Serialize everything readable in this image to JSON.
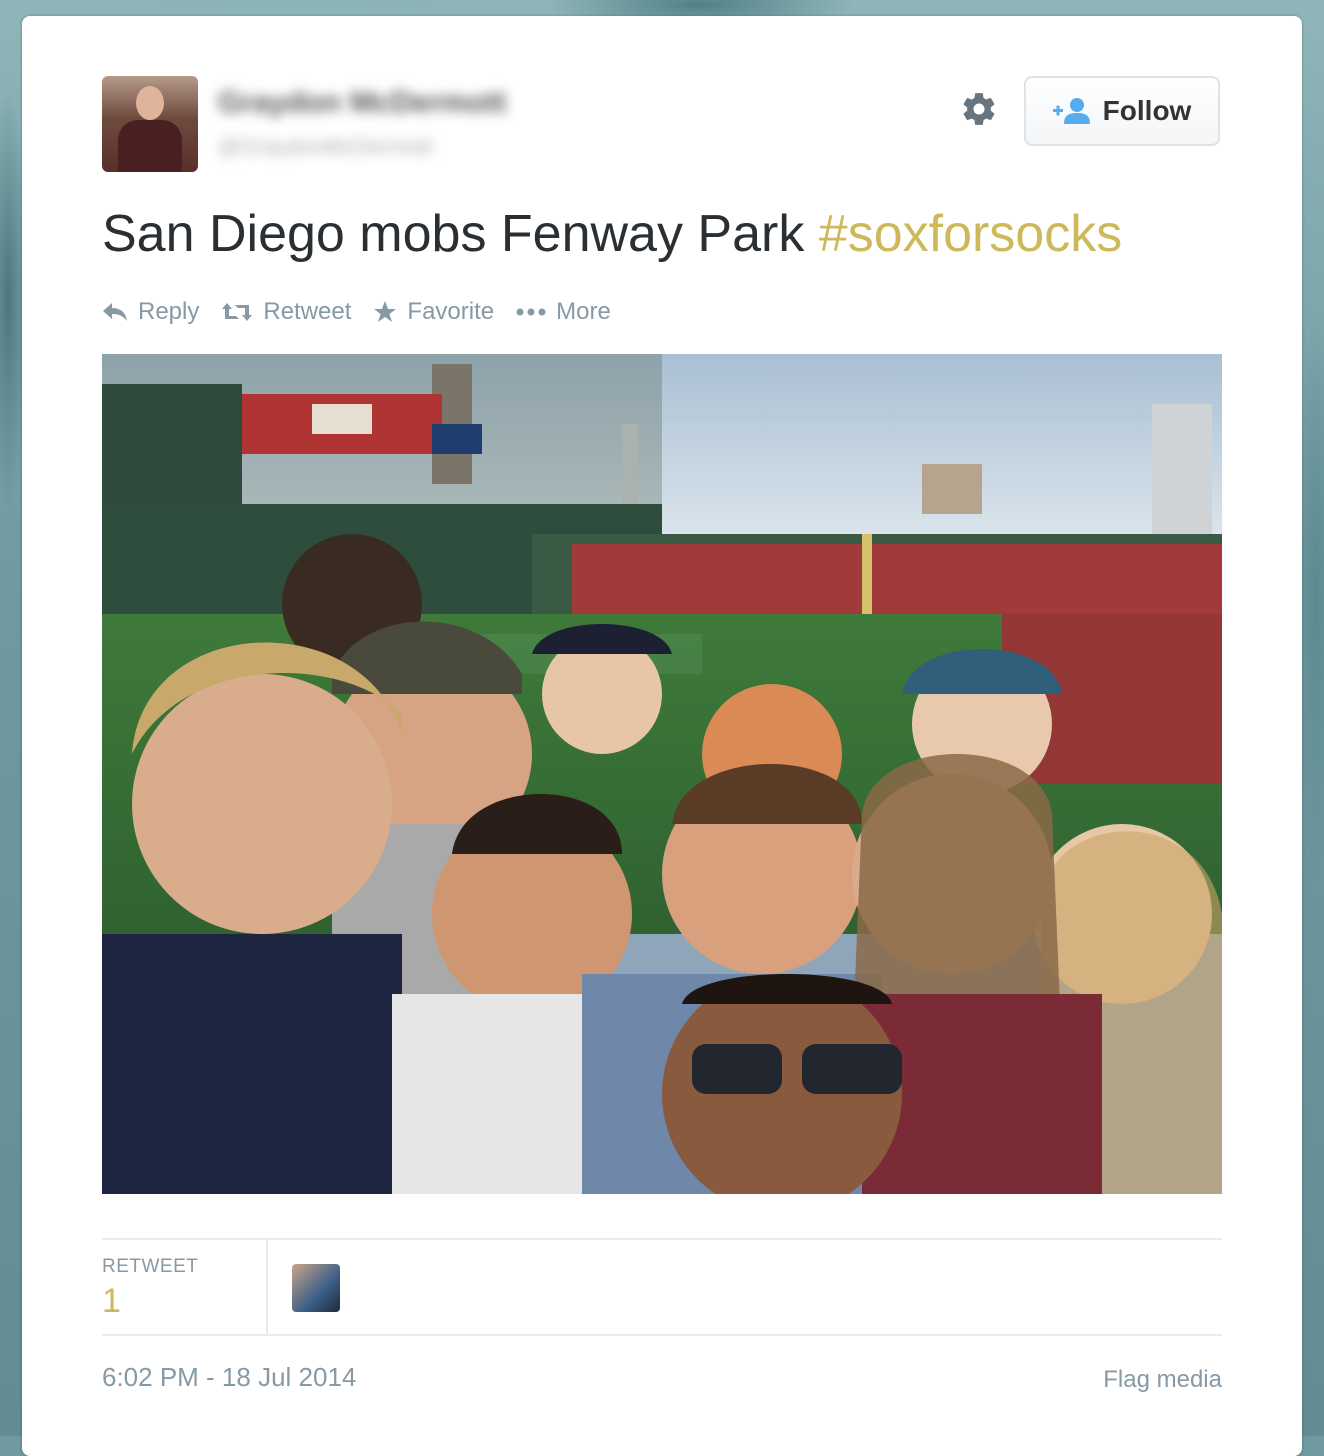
{
  "author": {
    "display_name": "Graydon McDermott",
    "handle": "@GraydonMcDermott"
  },
  "follow_button": {
    "label": "Follow"
  },
  "tweet": {
    "text": "San Diego mobs Fenway Park ",
    "hashtag": "#soxforsocks"
  },
  "actions": {
    "reply": "Reply",
    "retweet": "Retweet",
    "favorite": "Favorite",
    "more": "More"
  },
  "stats": {
    "retweet_label": "RETWEET",
    "retweet_count": "1"
  },
  "footer": {
    "timestamp": "6:02 PM - 18 Jul 2014",
    "flag_media": "Flag media"
  },
  "colors": {
    "hashtag": "#ceb95a",
    "action_gray": "#8899a6",
    "follow_icon_blue": "#55acee"
  },
  "icons": [
    "gear-icon",
    "follow-user-plus-icon",
    "reply-icon",
    "retweet-icon",
    "star-icon",
    "more-dots-icon"
  ]
}
